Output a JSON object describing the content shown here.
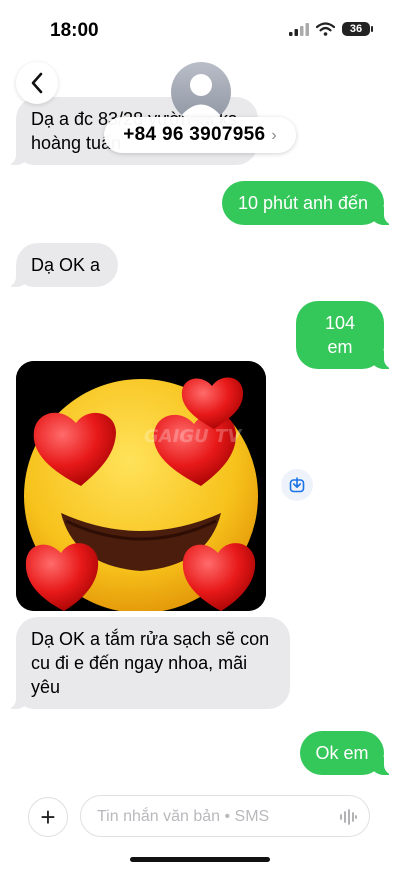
{
  "status": {
    "time": "18:00",
    "battery": "36"
  },
  "header": {
    "phone_number": "+84 96 3907956",
    "chevron": "›"
  },
  "messages": [
    {
      "from": "contact",
      "text": "Dạ a đc 83/28 vườn lài ks hoàng tuấn"
    },
    {
      "from": "me",
      "text": "10 phút anh đến"
    },
    {
      "from": "contact",
      "text": "Dạ OK a"
    },
    {
      "from": "me",
      "text": "104 em"
    },
    {
      "from": "contact",
      "type": "image",
      "watermark": "GAIGU TV"
    },
    {
      "from": "contact",
      "text": "Dạ OK a tắm rửa sạch sẽ con cu đi e đến ngay nhoa, mãi yêu"
    },
    {
      "from": "me",
      "text": "Ok em"
    }
  ],
  "composer": {
    "placeholder": "Tin nhắn văn bản • SMS",
    "plus": "+"
  },
  "colors": {
    "sent_bubble": "#34c759",
    "received_bubble": "#e9e9eb",
    "accent": "#0a7aff"
  },
  "icons": [
    "signal-icon",
    "wifi-icon",
    "battery-icon",
    "back-chevron-icon",
    "avatar-icon",
    "download-icon",
    "plus-icon",
    "microphone-waveform-icon"
  ]
}
